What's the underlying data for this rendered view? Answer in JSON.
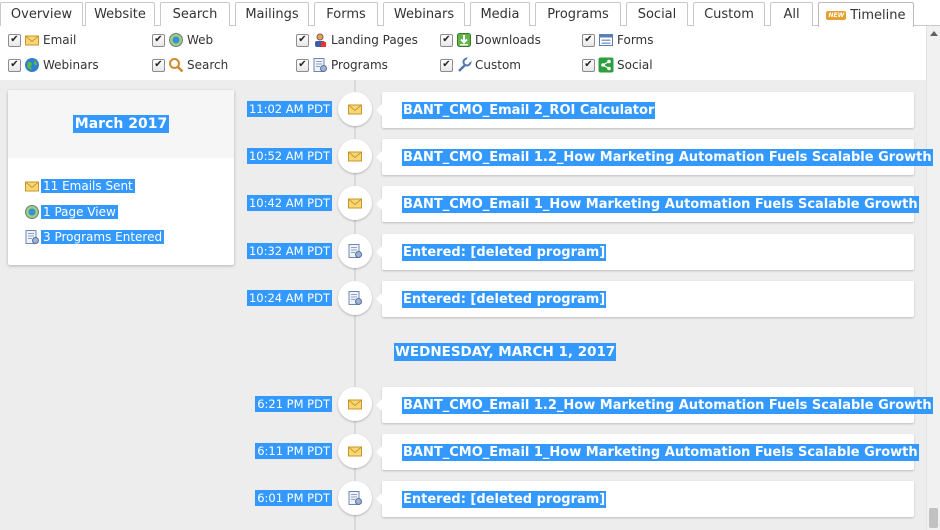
{
  "tabs": [
    {
      "label": "Overview"
    },
    {
      "label": "Website"
    },
    {
      "label": "Search"
    },
    {
      "label": "Mailings"
    },
    {
      "label": "Forms"
    },
    {
      "label": "Webinars"
    },
    {
      "label": "Media"
    },
    {
      "label": "Programs"
    },
    {
      "label": "Social"
    },
    {
      "label": "Custom"
    },
    {
      "label": "All"
    },
    {
      "label": "Timeline",
      "badge": "NEW"
    }
  ],
  "filters": [
    {
      "label": "Email",
      "icon": "envelope-icon",
      "checked": true
    },
    {
      "label": "Web",
      "icon": "globe-icon",
      "checked": true
    },
    {
      "label": "Landing Pages",
      "icon": "landing-page-icon",
      "checked": true
    },
    {
      "label": "Downloads",
      "icon": "download-icon",
      "checked": true
    },
    {
      "label": "Forms",
      "icon": "form-icon",
      "checked": true
    },
    {
      "label": "Webinars",
      "icon": "webinar-globe-icon",
      "checked": true
    },
    {
      "label": "Search",
      "icon": "magnifier-icon",
      "checked": true
    },
    {
      "label": "Programs",
      "icon": "program-icon",
      "checked": true
    },
    {
      "label": "Custom",
      "icon": "wrench-icon",
      "checked": true
    },
    {
      "label": "Social",
      "icon": "share-icon",
      "checked": true
    }
  ],
  "summary": {
    "month": "March 2017",
    "items": [
      {
        "text": "11 Emails Sent",
        "icon": "envelope-icon"
      },
      {
        "text": "1 Page View",
        "icon": "globe-icon"
      },
      {
        "text": "3 Programs Entered",
        "icon": "program-icon"
      }
    ]
  },
  "day_header": "WEDNESDAY, MARCH 1, 2017",
  "events": [
    {
      "time": "11:02 AM PDT",
      "title": "BANT_CMO_Email 2_ROI Calculator",
      "icon": "envelope-icon"
    },
    {
      "time": "10:52 AM PDT",
      "title": "BANT_CMO_Email 1.2_How Marketing Automation Fuels Scalable Growth",
      "icon": "envelope-icon"
    },
    {
      "time": "10:42 AM PDT",
      "title": "BANT_CMO_Email 1_How Marketing Automation Fuels Scalable Growth",
      "icon": "envelope-icon"
    },
    {
      "time": "10:32 AM PDT",
      "title": "Entered: [deleted program]",
      "icon": "program-icon"
    },
    {
      "time": "10:24 AM PDT",
      "title": "Entered: [deleted program]",
      "icon": "program-icon"
    },
    {
      "time": "6:21 PM PDT",
      "title": "BANT_CMO_Email 1.2_How Marketing Automation Fuels Scalable Growth",
      "icon": "envelope-icon"
    },
    {
      "time": "6:11 PM PDT",
      "title": "BANT_CMO_Email 1_How Marketing Automation Fuels Scalable Growth",
      "icon": "envelope-icon"
    },
    {
      "time": "6:01 PM PDT",
      "title": "Entered: [deleted program]",
      "icon": "program-icon"
    }
  ],
  "colors": {
    "selection": "#3399ff",
    "background": "#ededed",
    "card": "#ffffff",
    "timeline_line": "#dadada"
  }
}
